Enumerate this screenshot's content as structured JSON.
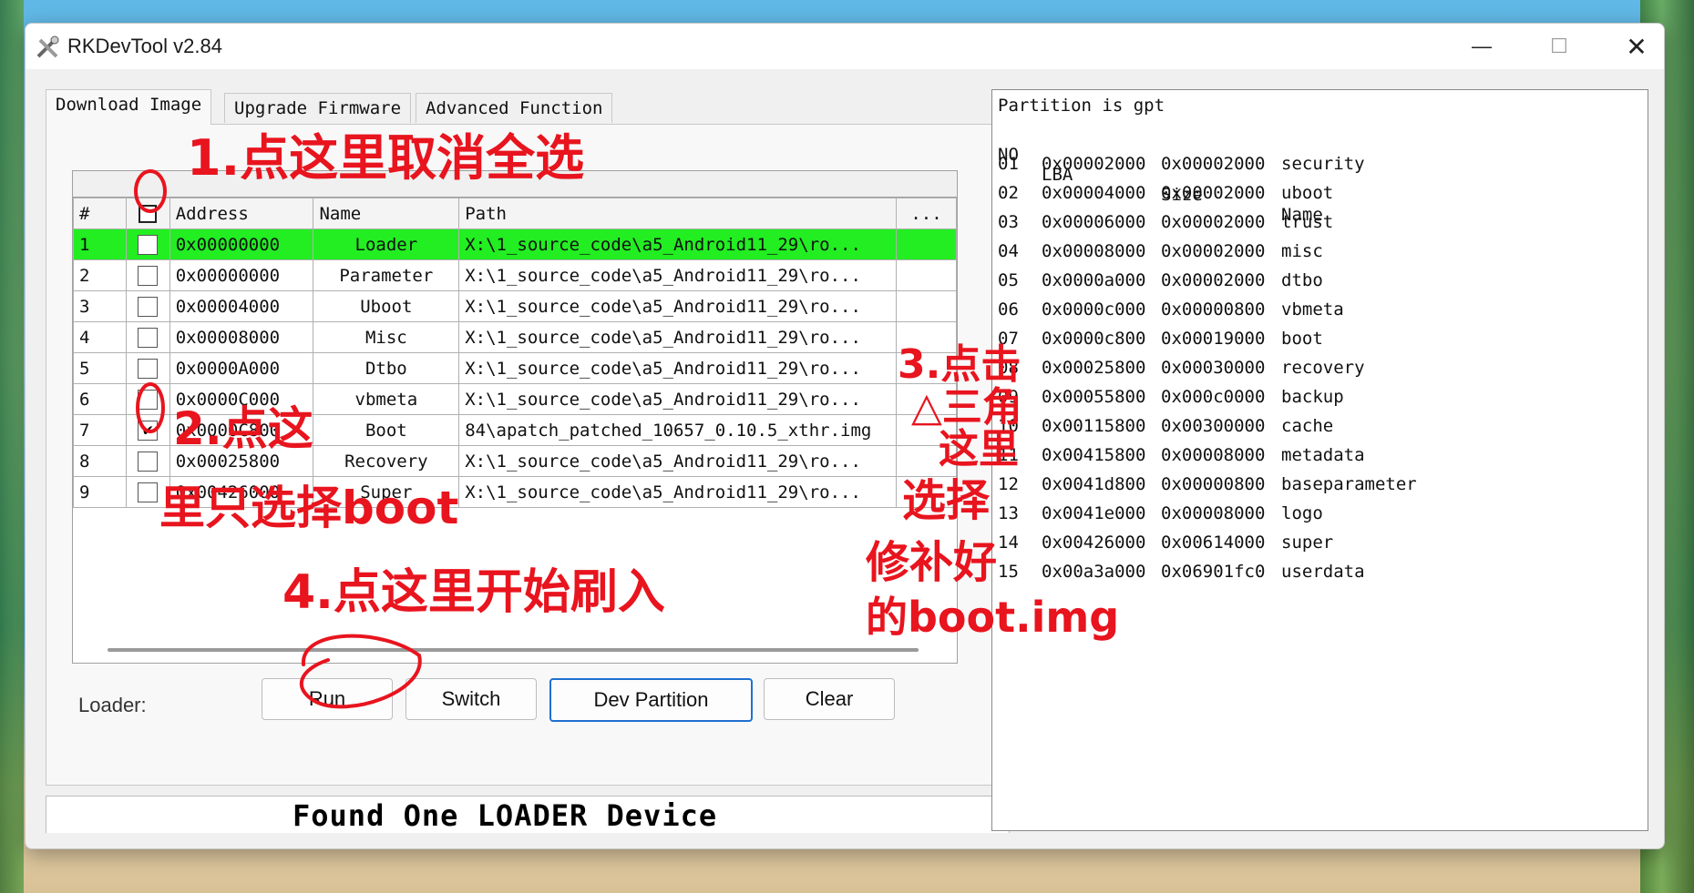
{
  "window": {
    "title": "RKDevTool v2.84",
    "min": "—",
    "max": "☐",
    "close": "✕"
  },
  "tabs": [
    {
      "label": "Download Image"
    },
    {
      "label": "Upgrade Firmware"
    },
    {
      "label": "Advanced Function"
    }
  ],
  "table": {
    "columns": [
      "#",
      "Address",
      "Name",
      "Path",
      "..."
    ],
    "rows": [
      {
        "no": "1",
        "checked": false,
        "address": "0x00000000",
        "name": "Loader",
        "path": "X:\\1_source_code\\a5_Android11_29\\ro..."
      },
      {
        "no": "2",
        "checked": false,
        "address": "0x00000000",
        "name": "Parameter",
        "path": "X:\\1_source_code\\a5_Android11_29\\ro..."
      },
      {
        "no": "3",
        "checked": false,
        "address": "0x00004000",
        "name": "Uboot",
        "path": "X:\\1_source_code\\a5_Android11_29\\ro..."
      },
      {
        "no": "4",
        "checked": false,
        "address": "0x00008000",
        "name": "Misc",
        "path": "X:\\1_source_code\\a5_Android11_29\\ro..."
      },
      {
        "no": "5",
        "checked": false,
        "address": "0x0000A000",
        "name": "Dtbo",
        "path": "X:\\1_source_code\\a5_Android11_29\\ro..."
      },
      {
        "no": "6",
        "checked": false,
        "address": "0x0000C000",
        "name": "vbmeta",
        "path": "X:\\1_source_code\\a5_Android11_29\\ro..."
      },
      {
        "no": "7",
        "checked": true,
        "address": "0x0000C800",
        "name": "Boot",
        "path": "84\\apatch_patched_10657_0.10.5_xthr.img"
      },
      {
        "no": "8",
        "checked": false,
        "address": "0x00025800",
        "name": "Recovery",
        "path": "X:\\1_source_code\\a5_Android11_29\\ro..."
      },
      {
        "no": "9",
        "checked": false,
        "address": "0x00426000",
        "name": "Super",
        "path": "X:\\1_source_code\\a5_Android11_29\\ro..."
      }
    ]
  },
  "loader_label": "Loader:",
  "buttons": {
    "run": "Run",
    "switch": "Switch",
    "dev_partition": "Dev Partition",
    "clear": "Clear"
  },
  "status": "Found One LOADER Device",
  "log": {
    "header": "Partition is gpt",
    "columns": {
      "no": "NO",
      "lba": "LBA",
      "size": "Size",
      "name": "Name"
    },
    "partitions": [
      {
        "no": "01",
        "lba": "0x00002000",
        "size": "0x00002000",
        "name": "security"
      },
      {
        "no": "02",
        "lba": "0x00004000",
        "size": "0x00002000",
        "name": "uboot"
      },
      {
        "no": "03",
        "lba": "0x00006000",
        "size": "0x00002000",
        "name": "trust"
      },
      {
        "no": "04",
        "lba": "0x00008000",
        "size": "0x00002000",
        "name": "misc"
      },
      {
        "no": "05",
        "lba": "0x0000a000",
        "size": "0x00002000",
        "name": "dtbo"
      },
      {
        "no": "06",
        "lba": "0x0000c000",
        "size": "0x00000800",
        "name": "vbmeta"
      },
      {
        "no": "07",
        "lba": "0x0000c800",
        "size": "0x00019000",
        "name": "boot"
      },
      {
        "no": "08",
        "lba": "0x00025800",
        "size": "0x00030000",
        "name": "recovery"
      },
      {
        "no": "09",
        "lba": "0x00055800",
        "size": "0x000c0000",
        "name": "backup"
      },
      {
        "no": "10",
        "lba": "0x00115800",
        "size": "0x00300000",
        "name": "cache"
      },
      {
        "no": "11",
        "lba": "0x00415800",
        "size": "0x00008000",
        "name": "metadata"
      },
      {
        "no": "12",
        "lba": "0x0041d800",
        "size": "0x00000800",
        "name": "baseparameter"
      },
      {
        "no": "13",
        "lba": "0x0041e000",
        "size": "0x00008000",
        "name": "logo"
      },
      {
        "no": "14",
        "lba": "0x00426000",
        "size": "0x00614000",
        "name": "super"
      },
      {
        "no": "15",
        "lba": "0x00a3a000",
        "size": "0x06901fc0",
        "name": "userdata"
      }
    ]
  },
  "annotations": {
    "step1": "1.点这里取消全选",
    "step2_a": "2.点这",
    "step2_b": "里只选择boot",
    "step3_a": "3.点击",
    "step3_b": "△三角",
    "step3_c": "这里",
    "step3_d": "选择",
    "step3_e": "修补好",
    "step3_f": "的boot.img",
    "step4": "4.点这里开始刷入",
    "color": "#e8141e"
  }
}
